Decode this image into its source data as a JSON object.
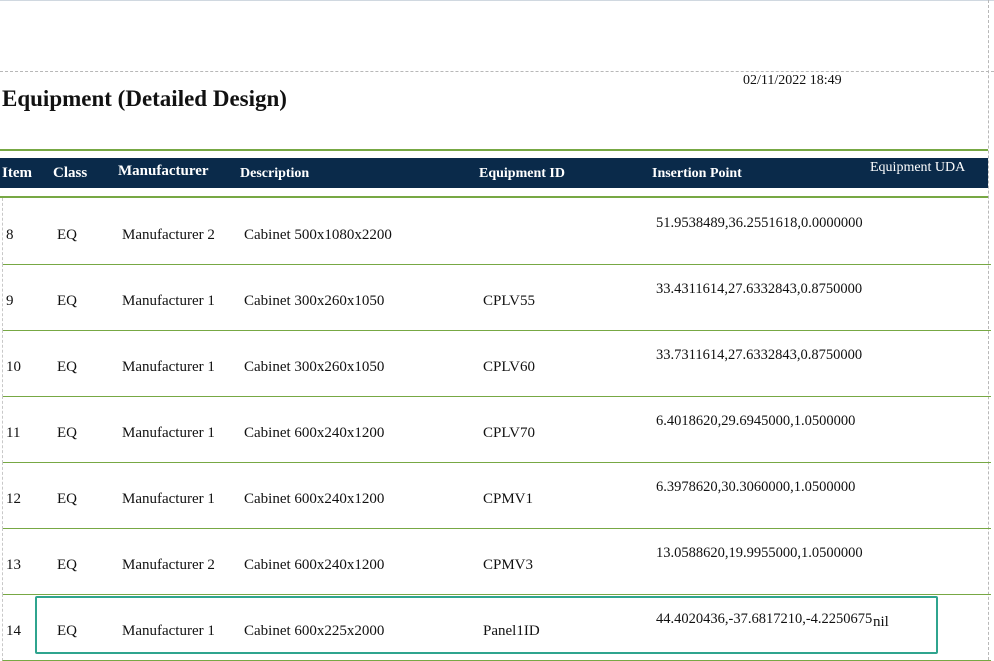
{
  "report": {
    "title": "Equipment (Detailed Design)",
    "timestamp": "02/11/2022 18:49"
  },
  "columns": {
    "item": "Item",
    "class": "Class",
    "manufacturer": "Manufacturer",
    "description": "Description",
    "equipment_id": "Equipment ID",
    "insertion_point": "Insertion Point",
    "equipment_uda": "Equipment UDA"
  },
  "rows": [
    {
      "item": "8",
      "class": "EQ",
      "manufacturer": "Manufacturer 2",
      "description": "Cabinet 500x1080x2200",
      "equipment_id": "",
      "insertion_point": "51.9538489,36.2551618,0.0000000",
      "equipment_uda": ""
    },
    {
      "item": "9",
      "class": "EQ",
      "manufacturer": "Manufacturer 1",
      "description": "Cabinet 300x260x1050",
      "equipment_id": "CPLV55",
      "insertion_point": "33.4311614,27.6332843,0.8750000",
      "equipment_uda": ""
    },
    {
      "item": "10",
      "class": "EQ",
      "manufacturer": "Manufacturer 1",
      "description": "Cabinet 300x260x1050",
      "equipment_id": "CPLV60",
      "insertion_point": "33.7311614,27.6332843,0.8750000",
      "equipment_uda": ""
    },
    {
      "item": "11",
      "class": "EQ",
      "manufacturer": "Manufacturer 1",
      "description": "Cabinet 600x240x1200",
      "equipment_id": "CPLV70",
      "insertion_point": "6.4018620,29.6945000,1.0500000",
      "equipment_uda": ""
    },
    {
      "item": "12",
      "class": "EQ",
      "manufacturer": "Manufacturer 1",
      "description": "Cabinet 600x240x1200",
      "equipment_id": "CPMV1",
      "insertion_point": "6.3978620,30.3060000,1.0500000",
      "equipment_uda": ""
    },
    {
      "item": "13",
      "class": "EQ",
      "manufacturer": "Manufacturer 2",
      "description": "Cabinet 600x240x1200",
      "equipment_id": "CPMV3",
      "insertion_point": "13.0588620,19.9955000,1.0500000",
      "equipment_uda": ""
    },
    {
      "item": "14",
      "class": "EQ",
      "manufacturer": "Manufacturer 1",
      "description": "Cabinet 600x225x2000",
      "equipment_id": "Panel1ID",
      "insertion_point": "44.4020436,-37.6817210,-4.2250675",
      "equipment_uda": "nil"
    }
  ],
  "colors": {
    "header_bg": "#0a2a4a",
    "rule": "#77a844",
    "highlight": "#2fa48e"
  }
}
